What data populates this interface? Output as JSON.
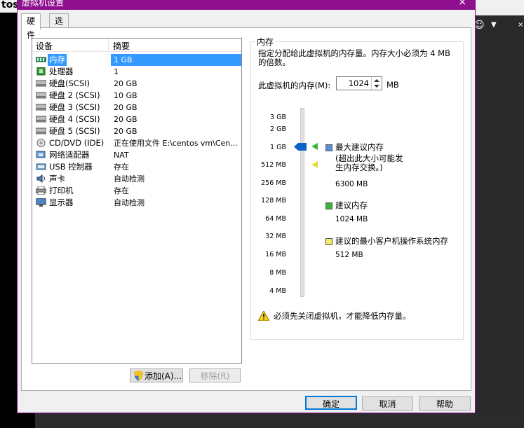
{
  "window": {
    "title": "虚拟机设置",
    "close_glyph": "×",
    "background_text": "tos"
  },
  "tabs": [
    {
      "label": "硬件",
      "active": true
    },
    {
      "label": "选项",
      "active": false
    }
  ],
  "device_list": {
    "headers": {
      "device": "设备",
      "summary": "摘要"
    },
    "rows": [
      {
        "icon": "memory-icon",
        "name": "内存",
        "summary": "1 GB",
        "selected": true
      },
      {
        "icon": "processor-icon",
        "name": "处理器",
        "summary": "1"
      },
      {
        "icon": "harddisk-icon",
        "name": "硬盘(SCSI)",
        "summary": "20 GB"
      },
      {
        "icon": "harddisk-icon",
        "name": "硬盘 2 (SCSI)",
        "summary": "10 GB"
      },
      {
        "icon": "harddisk-icon",
        "name": "硬盘 3 (SCSI)",
        "summary": "20 GB"
      },
      {
        "icon": "harddisk-icon",
        "name": "硬盘 4 (SCSI)",
        "summary": "20 GB"
      },
      {
        "icon": "harddisk-icon",
        "name": "硬盘 5 (SCSI)",
        "summary": "20 GB"
      },
      {
        "icon": "cd-dvd-icon",
        "name": "CD/DVD (IDE)",
        "summary": "正在使用文件 E:\\centos vm\\Cen..."
      },
      {
        "icon": "network-adapter-icon",
        "name": "网络适配器",
        "summary": "NAT"
      },
      {
        "icon": "usb-icon",
        "name": "USB 控制器",
        "summary": "存在"
      },
      {
        "icon": "sound-card-icon",
        "name": "声卡",
        "summary": "自动检测"
      },
      {
        "icon": "printer-icon",
        "name": "打印机",
        "summary": "存在"
      },
      {
        "icon": "display-icon",
        "name": "显示器",
        "summary": "自动检测"
      }
    ]
  },
  "list_buttons": {
    "add": "添加(A)...",
    "remove": "移除(R)"
  },
  "memory": {
    "group_title": "内存",
    "description": "指定分配给此虚拟机的内存量。内存大小必须为 4 MB 的倍数。",
    "label": "此虚拟机的内存(M):",
    "value": "1024",
    "unit": "MB",
    "scale_labels": [
      "3 GB",
      "2 GB",
      "1 GB",
      "512 MB",
      "256 MB",
      "128 MB",
      "64 MB",
      "32 MB",
      "16 MB",
      "8 MB",
      "4 MB"
    ],
    "max_recommended": {
      "title": "最大建议内存",
      "note": "(超出此大小可能发生内存交换。)",
      "value": "6300 MB",
      "color": "#5b8ed6"
    },
    "recommended": {
      "title": "建议内存",
      "value": "1024 MB",
      "color": "#3cb43c"
    },
    "min_guest": {
      "title": "建议的最小客户机操作系统内存",
      "value": "512 MB",
      "color": "#f2e86a"
    },
    "warning": "必须先关闭虚拟机，才能降低内存量。"
  },
  "footer_buttons": {
    "ok": "确定",
    "cancel": "取消",
    "help": "帮助"
  },
  "colors": {
    "titlebar": "#8e108e",
    "selection": "#3399ff",
    "slider_thumb": "#0a64c8"
  }
}
